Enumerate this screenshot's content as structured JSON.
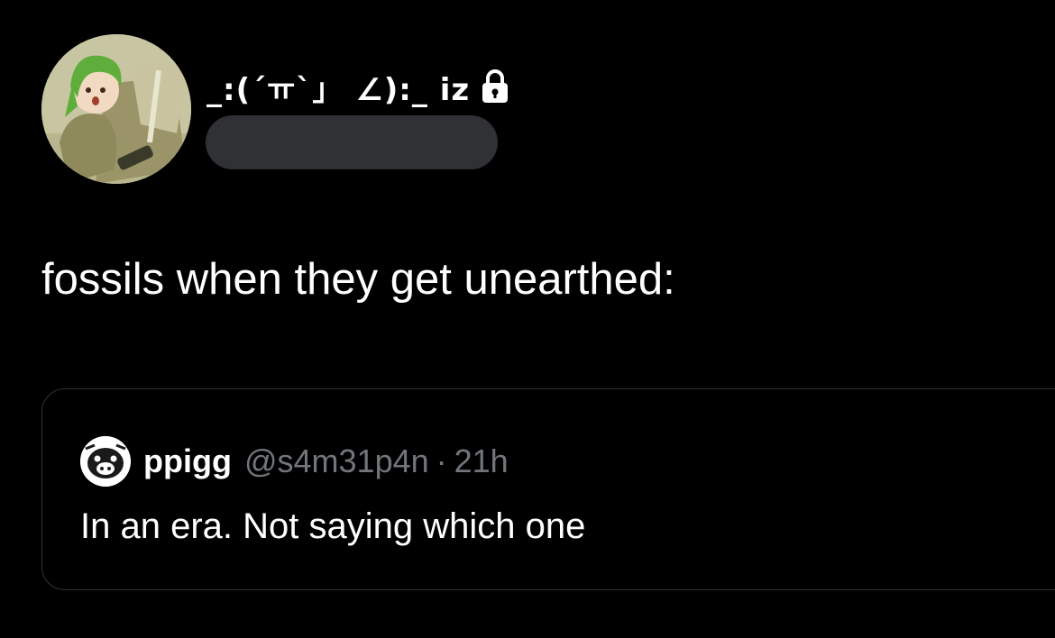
{
  "tweet": {
    "author": {
      "display_name": "_:(´ㅠ`」 ∠):_ iz",
      "avatar_icon": "user-avatar-icon",
      "protected_icon": "lock-icon",
      "handle_redacted": true
    },
    "text": "fossils when they get unearthed:"
  },
  "quote": {
    "avatar_icon": "user-avatar-icon",
    "name": "ppigg",
    "handle": "@s4m31p4n",
    "separator": "·",
    "time": "21h",
    "text": "In an era. Not saying which one"
  },
  "colors": {
    "background": "#000000",
    "primary_text": "#ffffff",
    "secondary_text": "#71767b",
    "border": "#2f3336",
    "redaction": "#2f3134"
  }
}
